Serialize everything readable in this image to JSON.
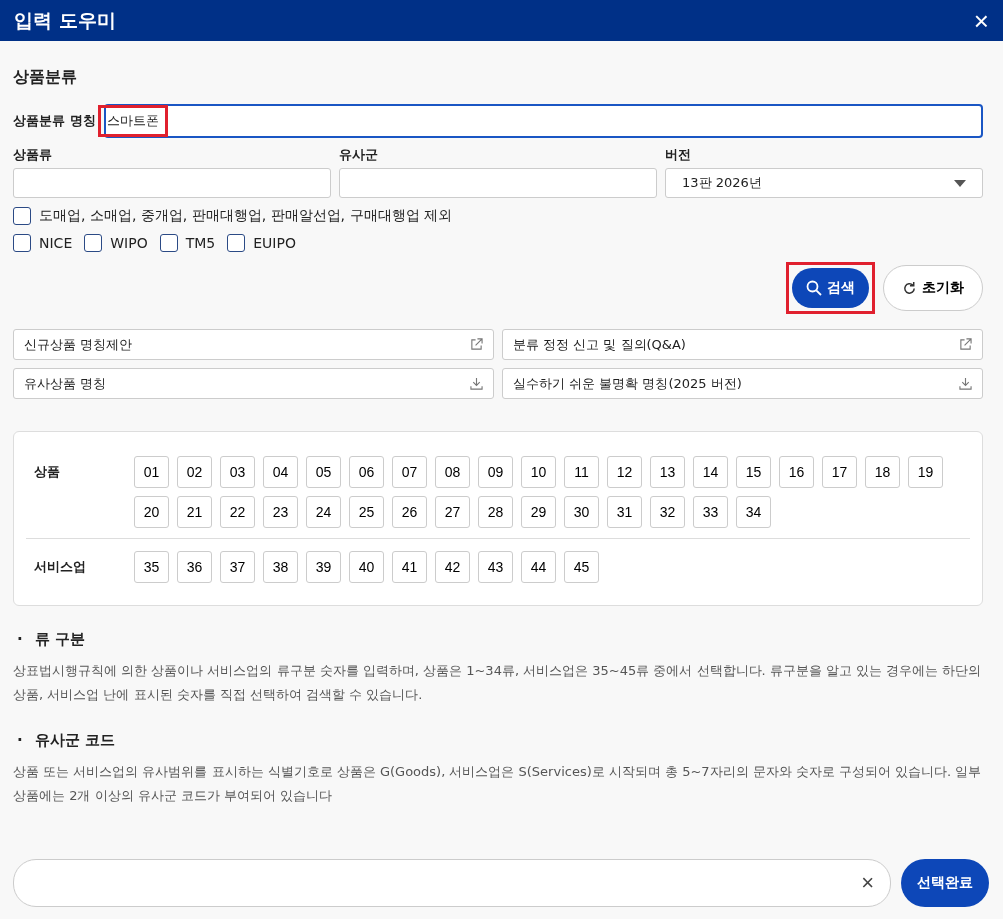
{
  "window": {
    "title": "입력 도우미",
    "close": "×"
  },
  "section_title": "상품분류",
  "name_field": {
    "label": "상품분류 명칭",
    "value": "스마트폰",
    "highlighted": true
  },
  "fields": [
    {
      "kind": "input",
      "label": "상품류"
    },
    {
      "kind": "input",
      "label": "유사군"
    },
    {
      "kind": "select",
      "label": "버전",
      "value": "13판 2026년"
    }
  ],
  "exclude_checkbox": {
    "label": "도매업, 소매업, 중개업, 판매대행업, 판매알선업, 구매대행업 제외",
    "checked": false
  },
  "source_checkboxes": [
    {
      "label": "NICE",
      "checked": false
    },
    {
      "label": "WIPO",
      "checked": false
    },
    {
      "label": "TM5",
      "checked": false
    },
    {
      "label": "EUIPO",
      "checked": false
    }
  ],
  "search_button": {
    "label": "검색",
    "highlighted": true
  },
  "reset_button": {
    "label": "초기화"
  },
  "links": [
    {
      "label": "신규상품 명칭제안",
      "kind": "external"
    },
    {
      "label": "분류 정정 신고 및 질의(Q&A)",
      "kind": "external"
    },
    {
      "label": "유사상품 명칭",
      "kind": "download"
    },
    {
      "label": "실수하기 쉬운 불명확 명칭(2025 버전)",
      "kind": "download"
    }
  ],
  "class_groups": [
    {
      "label": "상품",
      "classes": [
        {
          "label": "01",
          "selected": false
        },
        {
          "label": "02",
          "selected": false
        },
        {
          "label": "03",
          "selected": false
        },
        {
          "label": "04",
          "selected": false
        },
        {
          "label": "05",
          "selected": false
        },
        {
          "label": "06",
          "selected": false
        },
        {
          "label": "07",
          "selected": false
        },
        {
          "label": "08",
          "selected": false
        },
        {
          "label": "09",
          "selected": false
        },
        {
          "label": "10",
          "selected": false
        },
        {
          "label": "11",
          "selected": false
        },
        {
          "label": "12",
          "selected": false
        },
        {
          "label": "13",
          "selected": false
        },
        {
          "label": "14",
          "selected": false
        },
        {
          "label": "15",
          "selected": false
        },
        {
          "label": "16",
          "selected": false
        },
        {
          "label": "17",
          "selected": false
        },
        {
          "label": "18",
          "selected": false
        },
        {
          "label": "19",
          "selected": false
        },
        {
          "label": "20",
          "selected": false
        },
        {
          "label": "21",
          "selected": false
        },
        {
          "label": "22",
          "selected": false
        },
        {
          "label": "23",
          "selected": false
        },
        {
          "label": "24",
          "selected": false
        },
        {
          "label": "25",
          "selected": false
        },
        {
          "label": "26",
          "selected": false
        },
        {
          "label": "27",
          "selected": false
        },
        {
          "label": "28",
          "selected": false
        },
        {
          "label": "29",
          "selected": false
        },
        {
          "label": "30",
          "selected": false
        },
        {
          "label": "31",
          "selected": false
        },
        {
          "label": "32",
          "selected": false
        },
        {
          "label": "33",
          "selected": false
        },
        {
          "label": "34",
          "selected": false
        }
      ]
    },
    {
      "label": "서비스업",
      "classes": [
        {
          "label": "35",
          "selected": false
        },
        {
          "label": "36",
          "selected": false
        },
        {
          "label": "37",
          "selected": false
        },
        {
          "label": "38",
          "selected": false
        },
        {
          "label": "39",
          "selected": false
        },
        {
          "label": "40",
          "selected": false
        },
        {
          "label": "41",
          "selected": false
        },
        {
          "label": "42",
          "selected": false
        },
        {
          "label": "43",
          "selected": false
        },
        {
          "label": "44",
          "selected": false
        },
        {
          "label": "45",
          "selected": false
        }
      ]
    }
  ],
  "help": [
    {
      "bullet": "·",
      "title": "류 구분",
      "text": "상표법시행규칙에 의한 상품이나 서비스업의 류구분 숫자를 입력하며, 상품은 1~34류, 서비스업은 35~45류 중에서 선택합니다. 류구분을 알고 있는 경우에는 하단의 상품, 서비스업 난에 표시된 숫자를 직접 선택하여 검색할 수 있습니다."
    },
    {
      "bullet": "·",
      "title": "유사군 코드",
      "text": "상품 또는 서비스업의 유사범위를 표시하는 식별기호로 상품은 G(Goods), 서비스업은 S(Services)로 시작되며 총 5~7자리의 문자와 숫자로 구성되어 있습니다. 일부상품에는 2개 이상의 유사군 코드가 부여되어 있습니다"
    }
  ],
  "footer": {
    "clear": "×",
    "confirm_button": "선택완료"
  }
}
